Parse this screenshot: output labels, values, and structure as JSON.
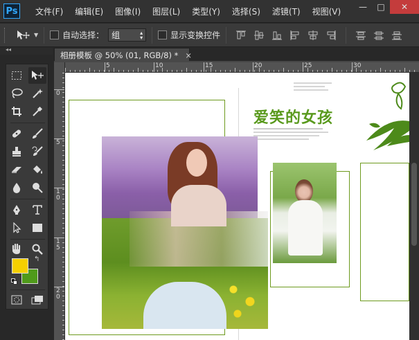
{
  "app": {
    "logo": "Ps"
  },
  "menu": [
    "文件(F)",
    "编辑(E)",
    "图像(I)",
    "图层(L)",
    "类型(Y)",
    "选择(S)",
    "滤镜(T)",
    "视图(V)"
  ],
  "window_controls": {
    "minimize": "—",
    "restore": "□",
    "close": "✕"
  },
  "options_bar": {
    "auto_select_label": "自动选择：",
    "auto_select_value": "组",
    "show_transform_label": "显示变换控件"
  },
  "document": {
    "tab_title": "相册模板 @ 50% (01, RGB/8) *",
    "close": "×"
  },
  "panel_collapse": "◂◂",
  "rulers": {
    "h": [
      {
        "label": "5"
      },
      {
        "label": "10"
      },
      {
        "label": "15"
      },
      {
        "label": "20"
      },
      {
        "label": "25"
      },
      {
        "label": "30"
      }
    ],
    "v": [
      {
        "label": "0"
      },
      {
        "label": "5"
      },
      {
        "label": "1\n0"
      },
      {
        "label": "1\n5"
      },
      {
        "label": "2\n0"
      }
    ]
  },
  "canvas": {
    "title_text": "爱笑的女孩",
    "accent_color": "#5a9a1e"
  },
  "colors": {
    "foreground": "#f5d000",
    "background": "#4f9a1a"
  },
  "icons": {
    "marquee": "rect-marquee-icon",
    "move": "move-icon",
    "lasso": "lasso-icon",
    "magic_wand": "magic-wand-icon",
    "crop": "crop-icon",
    "eyedropper": "eyedropper-icon",
    "healing": "healing-brush-icon",
    "brush": "brush-icon",
    "stamp": "clone-stamp-icon",
    "history_brush": "history-brush-icon",
    "eraser": "eraser-icon",
    "bucket": "paint-bucket-icon",
    "blur": "blur-icon",
    "dodge": "dodge-icon",
    "pen": "pen-icon",
    "type": "type-icon",
    "path_select": "path-selection-icon",
    "shape": "rectangle-shape-icon",
    "hand": "hand-icon",
    "zoom": "zoom-icon"
  }
}
